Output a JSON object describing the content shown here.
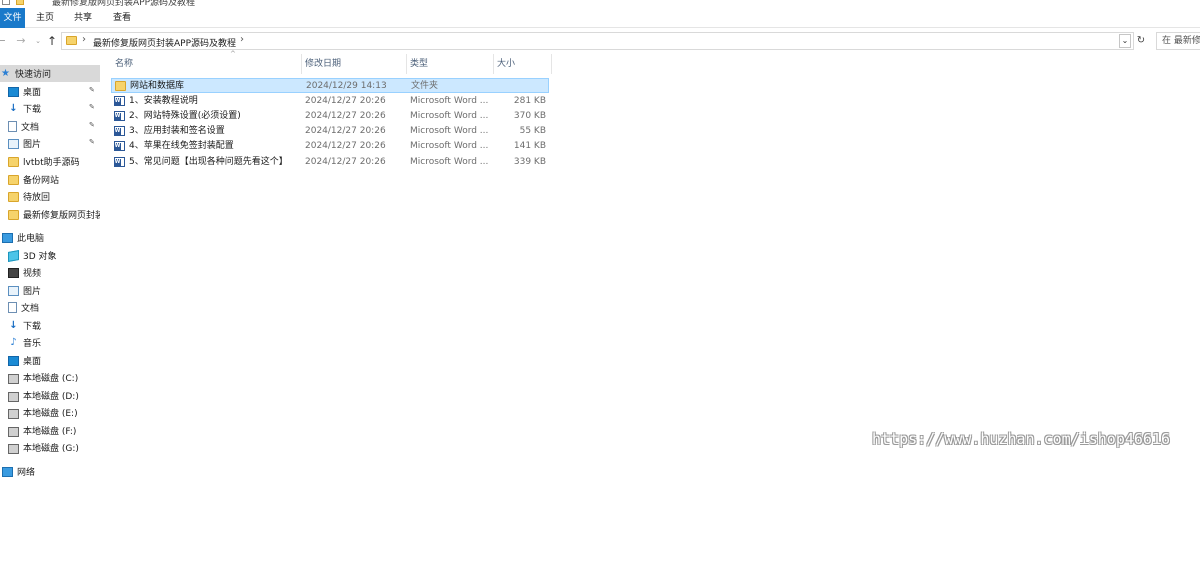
{
  "titlebar": {
    "path_text": "最新修复版网页封装APP源码及教程"
  },
  "ribbon": {
    "tabs": [
      "文件",
      "主页",
      "共享",
      "查看"
    ]
  },
  "nav": {
    "back": "←",
    "forward": "→",
    "recent": "⌄",
    "up": "↑",
    "refresh": "↻"
  },
  "address": {
    "separator": "›",
    "crumb": "最新修复版网页封装APP源码及教程",
    "dropdown": "⌄"
  },
  "search": {
    "text": "在 最新修复版网页封装APP源码及教程 中搜索"
  },
  "sidebar": {
    "quick_access": "快速访问",
    "quick_items": [
      {
        "label": "桌面",
        "icon": "desktop-icon",
        "pinned": true
      },
      {
        "label": "下载",
        "icon": "download-icon",
        "pinned": true
      },
      {
        "label": "文档",
        "icon": "documents-icon",
        "pinned": true
      },
      {
        "label": "图片",
        "icon": "pictures-icon",
        "pinned": true
      },
      {
        "label": "lvtbt助手源码",
        "icon": "folder-icon",
        "pinned": false
      },
      {
        "label": "备份网站",
        "icon": "folder-icon",
        "pinned": false
      },
      {
        "label": "待放回",
        "icon": "folder-icon",
        "pinned": false
      },
      {
        "label": "最新修复版网页封装APP源码及教程",
        "icon": "folder-icon",
        "pinned": false
      }
    ],
    "pin_glyph": "📌",
    "this_pc": "此电脑",
    "pc_items": [
      {
        "label": "3D 对象",
        "icon": "3d-objects-icon"
      },
      {
        "label": "视频",
        "icon": "videos-icon"
      },
      {
        "label": "图片",
        "icon": "pictures-icon"
      },
      {
        "label": "文档",
        "icon": "documents-icon"
      },
      {
        "label": "下载",
        "icon": "download-icon"
      },
      {
        "label": "音乐",
        "icon": "music-icon"
      },
      {
        "label": "桌面",
        "icon": "desktop-icon"
      },
      {
        "label": "本地磁盘 (C:)",
        "icon": "drive-icon"
      },
      {
        "label": "本地磁盘 (D:)",
        "icon": "drive-icon"
      },
      {
        "label": "本地磁盘 (E:)",
        "icon": "drive-icon"
      },
      {
        "label": "本地磁盘 (F:)",
        "icon": "drive-icon"
      },
      {
        "label": "本地磁盘 (G:)",
        "icon": "drive-icon"
      }
    ],
    "network": "网络"
  },
  "columns": {
    "name": "名称",
    "date": "修改日期",
    "type": "类型",
    "size": "大小",
    "sort_glyph": "^"
  },
  "files": [
    {
      "name": "网站和数据库",
      "date": "2024/12/29 14:13",
      "type": "文件夹",
      "size": "",
      "kind": "folder",
      "selected": true
    },
    {
      "name": "1、安装教程说明",
      "date": "2024/12/27 20:26",
      "type": "Microsoft Word ...",
      "size": "281 KB",
      "kind": "word",
      "selected": false
    },
    {
      "name": "2、网站特殊设置(必须设置)",
      "date": "2024/12/27 20:26",
      "type": "Microsoft Word ...",
      "size": "370 KB",
      "kind": "word",
      "selected": false
    },
    {
      "name": "3、应用封装和签名设置",
      "date": "2024/12/27 20:26",
      "type": "Microsoft Word ...",
      "size": "55 KB",
      "kind": "word",
      "selected": false
    },
    {
      "name": "4、苹果在线免签封装配置",
      "date": "2024/12/27 20:26",
      "type": "Microsoft Word ...",
      "size": "141 KB",
      "kind": "word",
      "selected": false
    },
    {
      "name": "5、常见问题【出现各种问题先看这个】",
      "date": "2024/12/27 20:26",
      "type": "Microsoft Word ...",
      "size": "339 KB",
      "kind": "word",
      "selected": false
    }
  ],
  "watermark": "https://www.huzhan.com/ishop46616"
}
